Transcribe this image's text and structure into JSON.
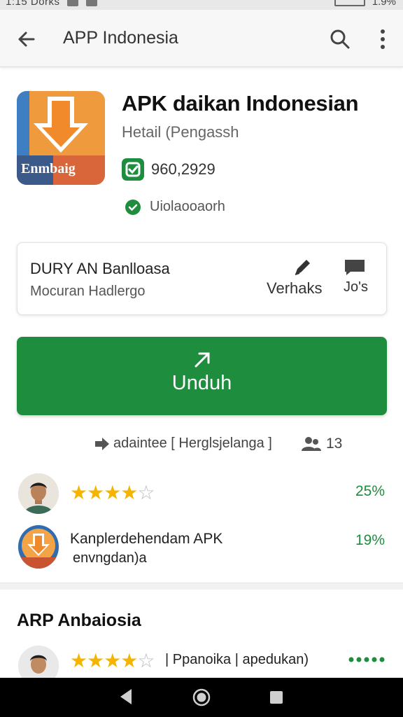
{
  "status_bar": {
    "time": "1:15",
    "carrier": "Dorks",
    "battery": "1.9%"
  },
  "app_bar": {
    "title": "APP Indonesia"
  },
  "app": {
    "title": "APK daikan Indonesian",
    "developer": "Hetail (Pengassh",
    "rating": "960,2929",
    "verified": "Uiolaooaorh",
    "icon_label": "Enmbaig"
  },
  "info_card": {
    "title": "DURY AN Banlloasa",
    "subtitle": "Mocuran Hadlergo",
    "edit_label": "Verhaks",
    "chat_label": "Jo's"
  },
  "download": {
    "label": "Unduh"
  },
  "meta": {
    "text": "adaintee  [ Herglsjelanga ]",
    "count": "13"
  },
  "reviews": [
    {
      "stars": 4,
      "percent": "25%"
    },
    {
      "line1": "Kanplerdehendam APK",
      "line2": "envngdan)a",
      "percent": "19%"
    }
  ],
  "section": {
    "title": "ARP Anbaiosia",
    "review": {
      "stars": 4,
      "text": "| Ppanoika | apedukan)"
    }
  },
  "colors": {
    "accent_green": "#1e8e3e",
    "star": "#f4b400",
    "icon_orange": "#e67e22"
  }
}
